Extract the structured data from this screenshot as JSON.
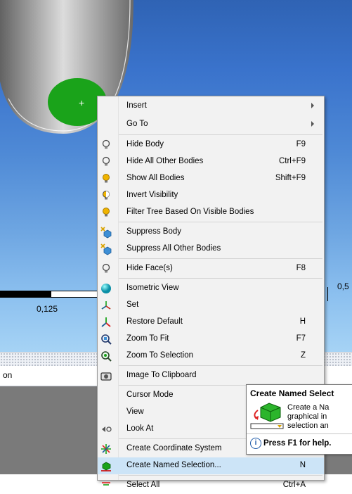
{
  "scale": {
    "left_label": "0,125",
    "right_label": "0,5"
  },
  "panel": {
    "header_text": "on"
  },
  "menu": {
    "items": [
      {
        "label": "Insert",
        "shortcut": "",
        "submenu": true,
        "icon": ""
      },
      {
        "label": "Go To",
        "shortcut": "",
        "submenu": true,
        "icon": ""
      },
      {
        "label": "Hide Body",
        "shortcut": "F9",
        "icon": "lightbulb-outline-icon"
      },
      {
        "label": "Hide All Other Bodies",
        "shortcut": "Ctrl+F9",
        "icon": "lightbulb-outline-icon"
      },
      {
        "label": "Show All Bodies",
        "shortcut": "Shift+F9",
        "icon": "lightbulb-on-icon"
      },
      {
        "label": "Invert Visibility",
        "shortcut": "",
        "icon": "lightbulb-invert-icon"
      },
      {
        "label": "Filter Tree Based On Visible Bodies",
        "shortcut": "",
        "icon": "lightbulb-on-icon"
      },
      {
        "label": "Suppress Body",
        "shortcut": "",
        "icon": "suppress-body-icon"
      },
      {
        "label": "Suppress All Other Bodies",
        "shortcut": "",
        "icon": "suppress-body-icon"
      },
      {
        "label": "Hide Face(s)",
        "shortcut": "F8",
        "icon": "lightbulb-outline-icon"
      },
      {
        "label": "Isometric View",
        "shortcut": "",
        "icon": "isometric-sphere-icon"
      },
      {
        "label": "Set",
        "shortcut": "",
        "icon": "set-axes-icon"
      },
      {
        "label": "Restore Default",
        "shortcut": "H",
        "icon": "restore-axes-icon"
      },
      {
        "label": "Zoom To Fit",
        "shortcut": "F7",
        "icon": "zoom-fit-icon"
      },
      {
        "label": "Zoom To Selection",
        "shortcut": "Z",
        "icon": "zoom-selection-icon"
      },
      {
        "label": "Image To Clipboard",
        "shortcut": "",
        "icon": "camera-icon"
      },
      {
        "label": "Cursor Mode",
        "shortcut": "",
        "icon": ""
      },
      {
        "label": "View",
        "shortcut": "",
        "icon": ""
      },
      {
        "label": "Look At",
        "shortcut": "",
        "icon": "look-at-icon"
      },
      {
        "label": "Create Coordinate System",
        "shortcut": "",
        "icon": "coordinate-system-icon"
      },
      {
        "label": "Create Named Selection...",
        "shortcut": "N",
        "icon": "named-selection-icon"
      },
      {
        "label": "Select All",
        "shortcut": "Ctrl+A",
        "icon": "select-all-icon"
      }
    ]
  },
  "tooltip": {
    "title": "Create Named Select",
    "body": "Create a Na graphical in selection an",
    "help": "Press F1 for help."
  },
  "colors": {
    "highlight": "#cce4f7",
    "viewport_top": "#2f63b4",
    "viewport_bottom": "#a6d3f5",
    "green_face": "#1aa31a"
  }
}
